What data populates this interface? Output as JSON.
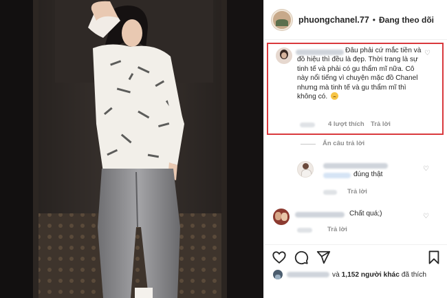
{
  "header": {
    "username": "phuongchanel.77",
    "separator": "•",
    "follow_status": "Đang theo dõi"
  },
  "highlighted_comment": {
    "text": "Đâu phải cứ mắc tiền và đồ hiệu thì đều là đẹp. Thời trang là sự tinh tế và phải có gu thẩm mĩ nữa. Cô này nổi tiếng vì chuyện mặc đồ Chanel nhưng mà tinh tế và gu thẩm mĩ thì không có.",
    "likes": "4 lượt thích",
    "reply": "Trả lời",
    "highlight_color": "#d9383c"
  },
  "hide_replies": "Ẩn câu trả lời",
  "replies": [
    {
      "text": "đúng thật",
      "reply": "Trả lời"
    },
    {
      "text": "Chất quá;)",
      "reply": "Trả lời"
    }
  ],
  "likes_summary": {
    "prefix": "và",
    "count_text": "1,152 người khác",
    "suffix": "đã thích"
  },
  "icons": [
    "heart-icon",
    "comment-icon",
    "share-icon",
    "bookmark-icon"
  ]
}
